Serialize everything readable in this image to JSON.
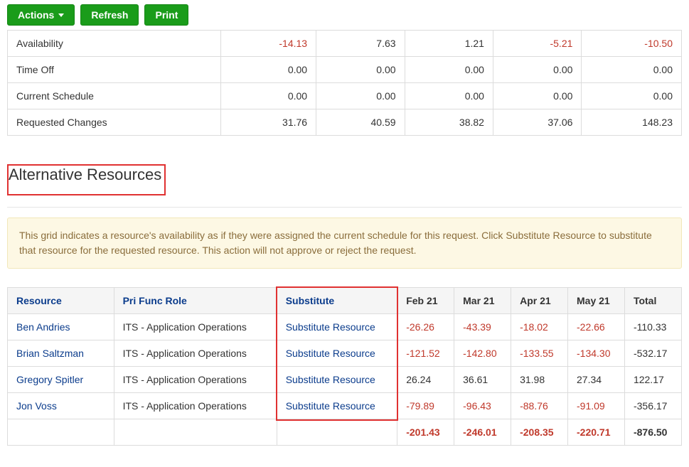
{
  "toolbar": {
    "actions_label": "Actions",
    "refresh_label": "Refresh",
    "print_label": "Print"
  },
  "summary": {
    "rows": [
      {
        "label": "Availability",
        "v1": "-14.13",
        "v2": "7.63",
        "v3": "1.21",
        "v4": "-5.21",
        "v5": "-10.50",
        "neg": [
          true,
          false,
          false,
          true,
          true
        ]
      },
      {
        "label": "Time Off",
        "v1": "0.00",
        "v2": "0.00",
        "v3": "0.00",
        "v4": "0.00",
        "v5": "0.00",
        "neg": [
          false,
          false,
          false,
          false,
          false
        ]
      },
      {
        "label": "Current Schedule",
        "v1": "0.00",
        "v2": "0.00",
        "v3": "0.00",
        "v4": "0.00",
        "v5": "0.00",
        "neg": [
          false,
          false,
          false,
          false,
          false
        ]
      },
      {
        "label": "Requested Changes",
        "v1": "31.76",
        "v2": "40.59",
        "v3": "38.82",
        "v4": "37.06",
        "v5": "148.23",
        "neg": [
          false,
          false,
          false,
          false,
          false
        ]
      }
    ]
  },
  "section": {
    "title": "Alternative Resources",
    "banner": "This grid indicates a resource's availability as if they were assigned the current schedule for this request. Click Substitute Resource to substitute that resource for the requested resource. This action will not approve or reject the request."
  },
  "alt": {
    "headers": {
      "resource": "Resource",
      "role": "Pri Func Role",
      "substitute": "Substitute",
      "feb": "Feb 21",
      "mar": "Mar 21",
      "apr": "Apr 21",
      "may": "May 21",
      "total": "Total"
    },
    "substitute_link": "Substitute Resource",
    "rows": [
      {
        "name": "Ben Andries",
        "role": "ITS - Application Operations",
        "feb": "-26.26",
        "mar": "-43.39",
        "apr": "-18.02",
        "may": "-22.66",
        "total": "-110.33",
        "neg": [
          true,
          true,
          true,
          true,
          false
        ]
      },
      {
        "name": "Brian Saltzman",
        "role": "ITS - Application Operations",
        "feb": "-121.52",
        "mar": "-142.80",
        "apr": "-133.55",
        "may": "-134.30",
        "total": "-532.17",
        "neg": [
          true,
          true,
          true,
          true,
          false
        ]
      },
      {
        "name": "Gregory Spitler",
        "role": "ITS - Application Operations",
        "feb": "26.24",
        "mar": "36.61",
        "apr": "31.98",
        "may": "27.34",
        "total": "122.17",
        "neg": [
          false,
          false,
          false,
          false,
          false
        ]
      },
      {
        "name": "Jon Voss",
        "role": "ITS - Application Operations",
        "feb": "-79.89",
        "mar": "-96.43",
        "apr": "-88.76",
        "may": "-91.09",
        "total": "-356.17",
        "neg": [
          true,
          true,
          true,
          true,
          false
        ]
      }
    ],
    "totals": {
      "feb": "-201.43",
      "mar": "-246.01",
      "apr": "-208.35",
      "may": "-220.71",
      "total": "-876.50"
    }
  }
}
